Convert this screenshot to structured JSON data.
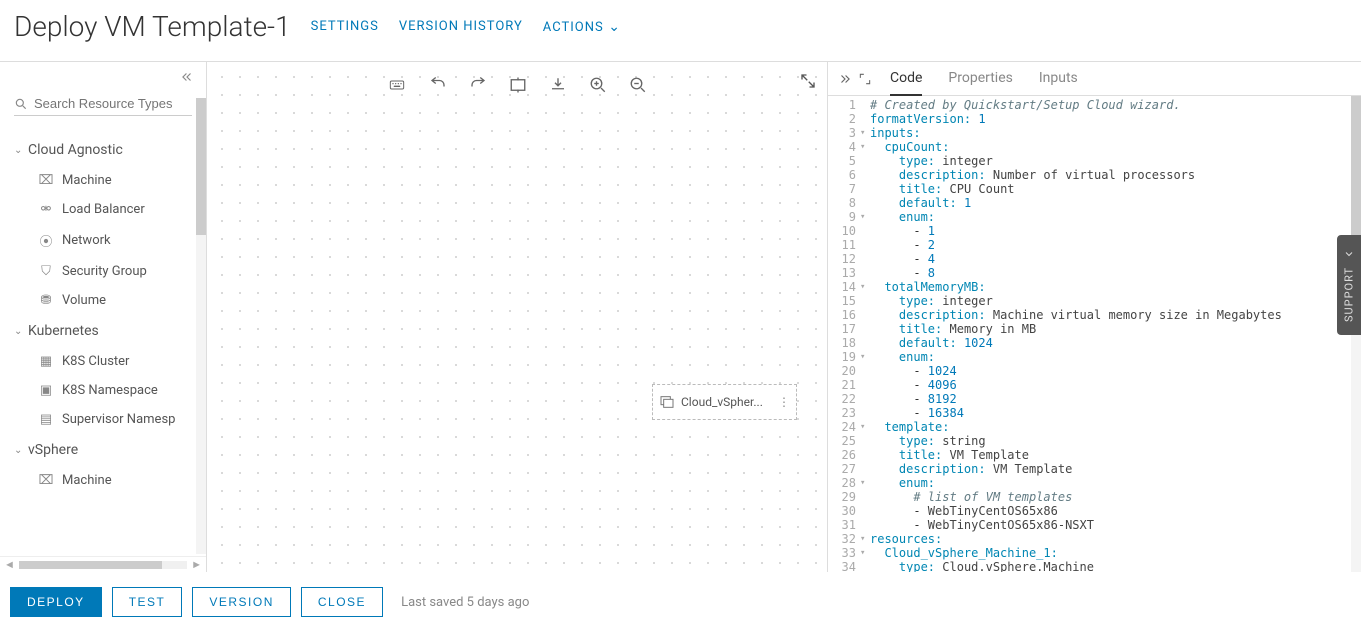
{
  "header": {
    "title": "Deploy VM Template-1",
    "links": {
      "settings": "SETTINGS",
      "history": "VERSION HISTORY",
      "actions": "ACTIONS"
    }
  },
  "sidebar": {
    "search_placeholder": "Search Resource Types",
    "groups": [
      {
        "label": "Cloud Agnostic",
        "items": [
          "Machine",
          "Load Balancer",
          "Network",
          "Security Group",
          "Volume"
        ]
      },
      {
        "label": "Kubernetes",
        "items": [
          "K8S Cluster",
          "K8S Namespace",
          "Supervisor Namesp"
        ]
      },
      {
        "label": "vSphere",
        "items": [
          "Machine"
        ]
      }
    ]
  },
  "canvas": {
    "node_label": "Cloud_vSpher..."
  },
  "code_panel": {
    "tabs": {
      "code": "Code",
      "properties": "Properties",
      "inputs": "Inputs"
    },
    "lines": [
      {
        "n": 1,
        "f": "",
        "html": "<span class='c'># Created by Quickstart/Setup Cloud wizard.</span>"
      },
      {
        "n": 2,
        "f": "",
        "html": "<span class='k'>formatVersion:</span> <span class='n'>1</span>"
      },
      {
        "n": 3,
        "f": "▾",
        "html": "<span class='k'>inputs:</span>"
      },
      {
        "n": 4,
        "f": "▾",
        "html": "  <span class='k'>cpuCount:</span>"
      },
      {
        "n": 5,
        "f": "",
        "html": "    <span class='k'>type:</span> <span class='t'>integer</span>"
      },
      {
        "n": 6,
        "f": "",
        "html": "    <span class='k'>description:</span> <span class='t'>Number of virtual processors</span>"
      },
      {
        "n": 7,
        "f": "",
        "html": "    <span class='k'>title:</span> <span class='t'>CPU Count</span>"
      },
      {
        "n": 8,
        "f": "",
        "html": "    <span class='k'>default:</span> <span class='n'>1</span>"
      },
      {
        "n": 9,
        "f": "▾",
        "html": "    <span class='k'>enum:</span>"
      },
      {
        "n": 10,
        "f": "",
        "html": "      - <span class='n'>1</span>"
      },
      {
        "n": 11,
        "f": "",
        "html": "      - <span class='n'>2</span>"
      },
      {
        "n": 12,
        "f": "",
        "html": "      - <span class='n'>4</span>"
      },
      {
        "n": 13,
        "f": "",
        "html": "      - <span class='n'>8</span>"
      },
      {
        "n": 14,
        "f": "▾",
        "html": "  <span class='k'>totalMemoryMB:</span>"
      },
      {
        "n": 15,
        "f": "",
        "html": "    <span class='k'>type:</span> <span class='t'>integer</span>"
      },
      {
        "n": 16,
        "f": "",
        "html": "    <span class='k'>description:</span> <span class='t'>Machine virtual memory size in Megabytes</span>"
      },
      {
        "n": 17,
        "f": "",
        "html": "    <span class='k'>title:</span> <span class='t'>Memory in MB</span>"
      },
      {
        "n": 18,
        "f": "",
        "html": "    <span class='k'>default:</span> <span class='n'>1024</span>"
      },
      {
        "n": 19,
        "f": "▾",
        "html": "    <span class='k'>enum:</span>"
      },
      {
        "n": 20,
        "f": "",
        "html": "      - <span class='n'>1024</span>"
      },
      {
        "n": 21,
        "f": "",
        "html": "      - <span class='n'>4096</span>"
      },
      {
        "n": 22,
        "f": "",
        "html": "      - <span class='n'>8192</span>"
      },
      {
        "n": 23,
        "f": "",
        "html": "      - <span class='n'>16384</span>"
      },
      {
        "n": 24,
        "f": "▾",
        "html": "  <span class='k'>template:</span>"
      },
      {
        "n": 25,
        "f": "",
        "html": "    <span class='k'>type:</span> <span class='t'>string</span>"
      },
      {
        "n": 26,
        "f": "",
        "html": "    <span class='k'>title:</span> <span class='t'>VM Template</span>"
      },
      {
        "n": 27,
        "f": "",
        "html": "    <span class='k'>description:</span> <span class='t'>VM Template</span>"
      },
      {
        "n": 28,
        "f": "▾",
        "html": "    <span class='k'>enum:</span>"
      },
      {
        "n": 29,
        "f": "",
        "html": "      <span class='c'># list of VM templates</span>"
      },
      {
        "n": 30,
        "f": "",
        "html": "      - <span class='t'>WebTinyCentOS65x86</span>"
      },
      {
        "n": 31,
        "f": "",
        "html": "      - <span class='t'>WebTinyCentOS65x86-NSXT</span>"
      },
      {
        "n": 32,
        "f": "▾",
        "html": "<span class='k'>resources:</span>"
      },
      {
        "n": 33,
        "f": "▾",
        "html": "  <span class='k'>Cloud_vSphere_Machine_1:</span>"
      },
      {
        "n": 34,
        "f": "",
        "html": "    <span class='k'>type:</span> <span class='t'>Cloud.vSphere.Machine</span>"
      }
    ]
  },
  "footer": {
    "deploy": "DEPLOY",
    "test": "TEST",
    "version": "VERSION",
    "close": "CLOSE",
    "status": "Last saved 5 days ago"
  },
  "support": "SUPPORT"
}
